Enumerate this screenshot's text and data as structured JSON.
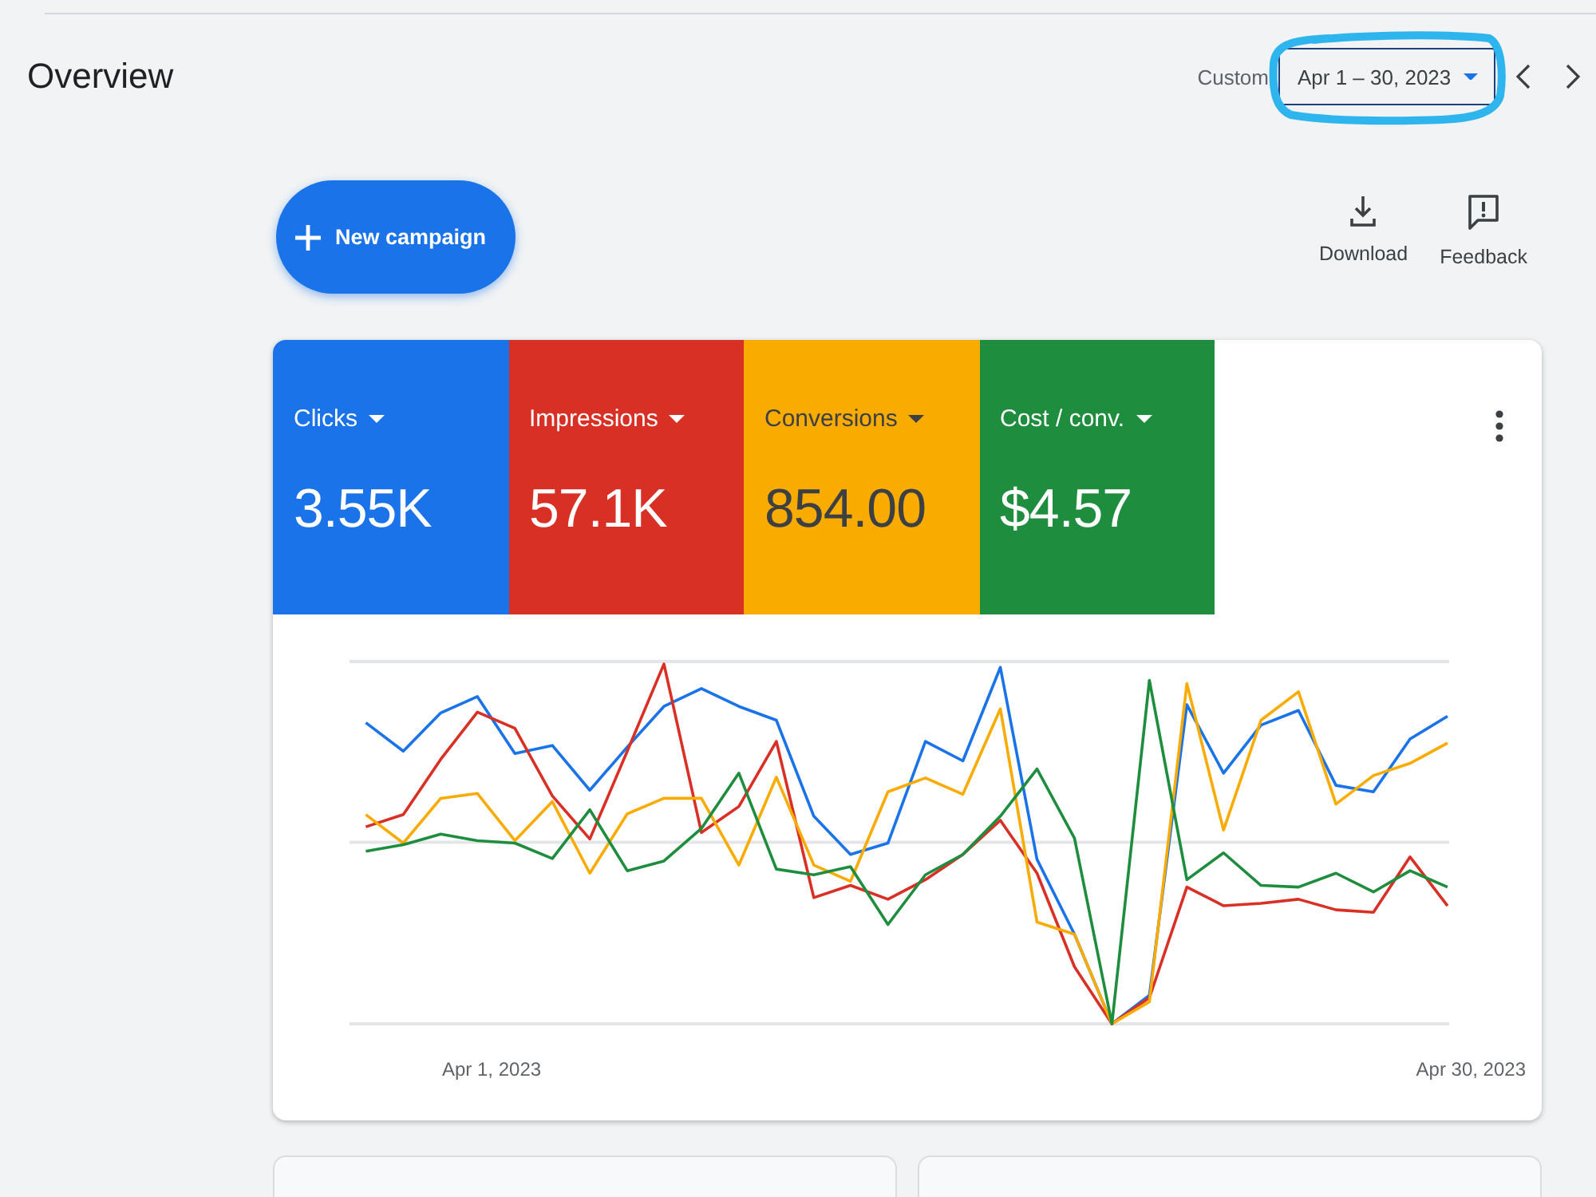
{
  "header": {
    "title": "Overview",
    "date_range": {
      "label": "Custom",
      "value": "Apr 1 – 30, 2023",
      "highlighted": true
    }
  },
  "toolbar": {
    "primary_button": "New campaign",
    "actions": [
      {
        "kind": "download",
        "label": "Download"
      },
      {
        "kind": "feedback",
        "label": "Feedback"
      }
    ]
  },
  "metrics": [
    {
      "label": "Clicks",
      "value": "3.55K",
      "color": "#1a73e8"
    },
    {
      "label": "Impressions",
      "value": "57.1K",
      "color": "#d93025"
    },
    {
      "label": "Conversions",
      "value": "854.00",
      "color": "#f9ab00"
    },
    {
      "label": "Cost / conv.",
      "value": "$4.57",
      "color": "#1e8e3e"
    }
  ],
  "chart": {
    "x_start": "Apr 1, 2023",
    "x_end": "Apr 30, 2023"
  }
}
